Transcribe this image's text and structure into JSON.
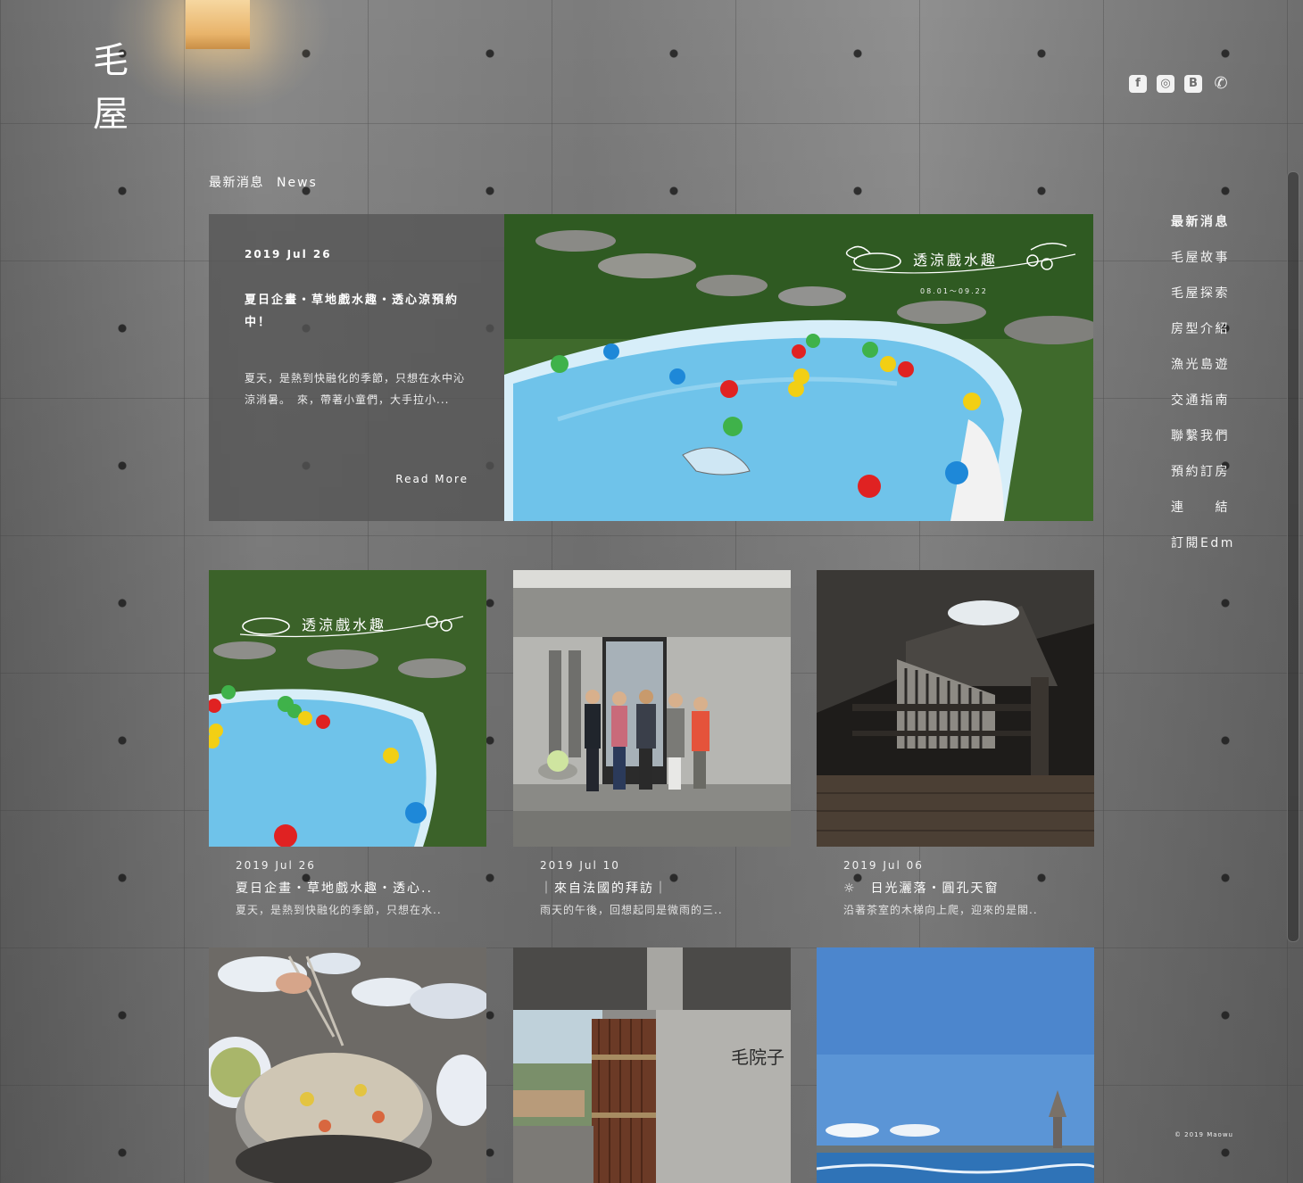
{
  "site": {
    "logo_line1": "毛",
    "logo_line2": "屋",
    "copyright": "© 2019 Maowu"
  },
  "social": [
    {
      "icon": "facebook-icon",
      "glyph": "f"
    },
    {
      "icon": "instagram-icon",
      "glyph": "◎"
    },
    {
      "icon": "blogger-icon",
      "glyph": "B"
    },
    {
      "icon": "phone-icon",
      "glyph": "✆"
    }
  ],
  "section": {
    "title_zh": "最新消息",
    "title_en": "News"
  },
  "featured": {
    "date": "2019 Jul 26",
    "title": "夏日企畫・草地戲水趣・透心涼預約中！",
    "excerpt": "夏天，是熱到快融化的季節，只想在水中沁涼消暑。　來，帶著小童們，大手拉小...",
    "read_more": "Read More",
    "image_caption": "透涼戲水趣",
    "image_dates": "08.01～09.22"
  },
  "cards": [
    {
      "date": "2019 Jul 26",
      "title": "夏日企畫・草地戲水趣・透心..",
      "excerpt": "夏天，是熱到快融化的季節，只想在水..",
      "image_caption": "透涼戲水趣"
    },
    {
      "date": "2019 Jul 10",
      "title": "｜來自法國的拜訪｜",
      "excerpt": "雨天的午後，回想起同是微雨的三.."
    },
    {
      "date": "2019 Jul 06",
      "title": "☼　日光灑落・圓孔天窗",
      "excerpt": "沿著茶室的木梯向上爬，迎來的是閣.."
    }
  ],
  "bottom_sign": "毛院子",
  "nav": [
    "最新消息",
    "毛屋故事",
    "毛屋探索",
    "房型介紹",
    "漁光島遊",
    "交通指南",
    "聯繫我們",
    "預約訂房",
    "連　　結",
    "訂閱Edm"
  ]
}
